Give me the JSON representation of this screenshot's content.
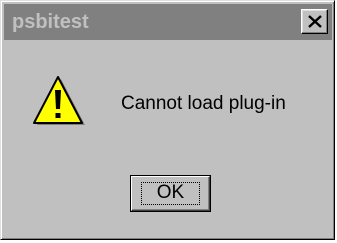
{
  "window": {
    "title": "psbitest",
    "close_symbol": "×"
  },
  "dialog": {
    "icon": "warning-icon",
    "message": "Cannot load plug-in",
    "ok_label": "OK"
  },
  "colors": {
    "face": "#c0c0c0",
    "titlebar_inactive": "#808080",
    "title_text": "#c0c0c0",
    "warning_fill": "#ffff00"
  }
}
